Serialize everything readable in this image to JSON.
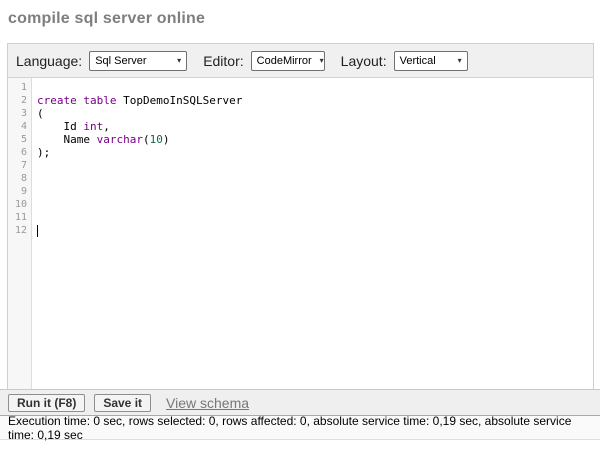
{
  "title": "compile sql server online",
  "toolbar": {
    "language": {
      "label": "Language:",
      "value": "Sql Server"
    },
    "editor": {
      "label": "Editor:",
      "value": "CodeMirror"
    },
    "layout": {
      "label": "Layout:",
      "value": "Vertical"
    }
  },
  "icons": {
    "dropdown_arrow": "▾"
  },
  "code_editor": {
    "cursor_line": 12,
    "syntax_colors": {
      "keyword": "#770088",
      "number": "#116644",
      "plain": "#000000"
    },
    "lines": [
      {
        "num": "1",
        "segments": []
      },
      {
        "num": "2",
        "segments": [
          {
            "text": "create table",
            "type": "keyword"
          },
          {
            "text": " TopDemoInSQLServer",
            "type": "plain"
          }
        ]
      },
      {
        "num": "3",
        "segments": [
          {
            "text": "(",
            "type": "plain"
          }
        ]
      },
      {
        "num": "4",
        "segments": [
          {
            "text": "    Id ",
            "type": "plain"
          },
          {
            "text": "int",
            "type": "keyword"
          },
          {
            "text": ",",
            "type": "plain"
          }
        ]
      },
      {
        "num": "5",
        "segments": [
          {
            "text": "    Name ",
            "type": "plain"
          },
          {
            "text": "varchar",
            "type": "keyword"
          },
          {
            "text": "(",
            "type": "plain"
          },
          {
            "text": "10",
            "type": "number"
          },
          {
            "text": ")",
            "type": "plain"
          }
        ]
      },
      {
        "num": "6",
        "segments": [
          {
            "text": ");",
            "type": "plain"
          }
        ]
      },
      {
        "num": "7",
        "segments": []
      },
      {
        "num": "8",
        "segments": []
      },
      {
        "num": "9",
        "segments": []
      },
      {
        "num": "10",
        "segments": []
      },
      {
        "num": "11",
        "segments": []
      },
      {
        "num": "12",
        "segments": []
      }
    ]
  },
  "actions": {
    "run_label": "Run it (F8)",
    "save_label": "Save it",
    "view_schema_label": "View schema"
  },
  "status_bar": {
    "text": "Execution time: 0 sec, rows selected: 0, rows affected: 0, absolute service time: 0,19 sec, absolute service time: 0,19 sec"
  }
}
